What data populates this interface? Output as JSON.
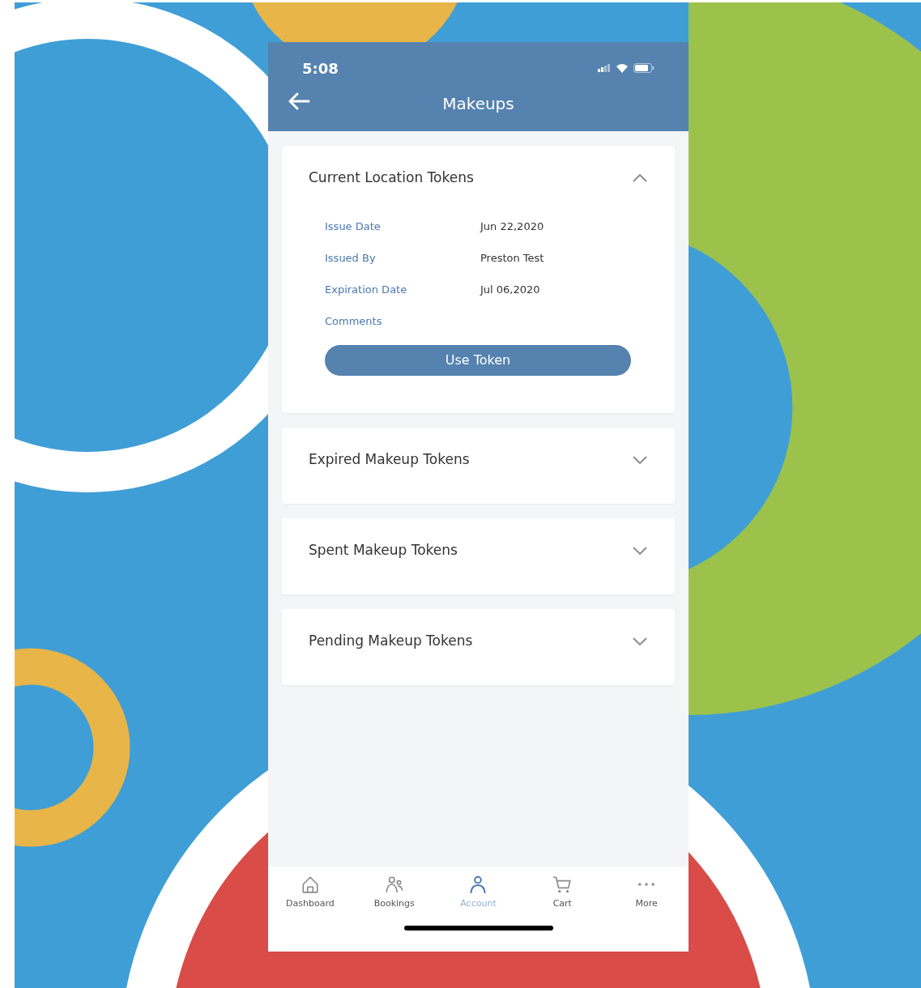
{
  "status_bar": {
    "time": "5:08"
  },
  "header": {
    "title": "Makeups"
  },
  "sections": [
    {
      "title": "Current Location Tokens",
      "expanded": true,
      "details": [
        {
          "label": "Issue Date",
          "value": "Jun 22,2020"
        },
        {
          "label": "Issued By",
          "value": "Preston Test"
        },
        {
          "label": "Expiration Date",
          "value": "Jul 06,2020"
        },
        {
          "label": "Comments"
        }
      ],
      "button": "Use Token"
    },
    {
      "title": "Expired Makeup Tokens",
      "expanded": false
    },
    {
      "title": "Spent Makeup Tokens",
      "expanded": false
    },
    {
      "title": "Pending Makeup Tokens",
      "expanded": false
    }
  ],
  "tab_bar": [
    {
      "kind": "home",
      "label": "Dashboard",
      "selected": false
    },
    {
      "kind": "people",
      "label": "Bookings",
      "selected": false
    },
    {
      "kind": "person",
      "label": "Account",
      "selected": true
    },
    {
      "kind": "cart",
      "label": "Cart",
      "selected": false
    },
    {
      "kind": "more",
      "label": "More",
      "selected": false
    }
  ]
}
